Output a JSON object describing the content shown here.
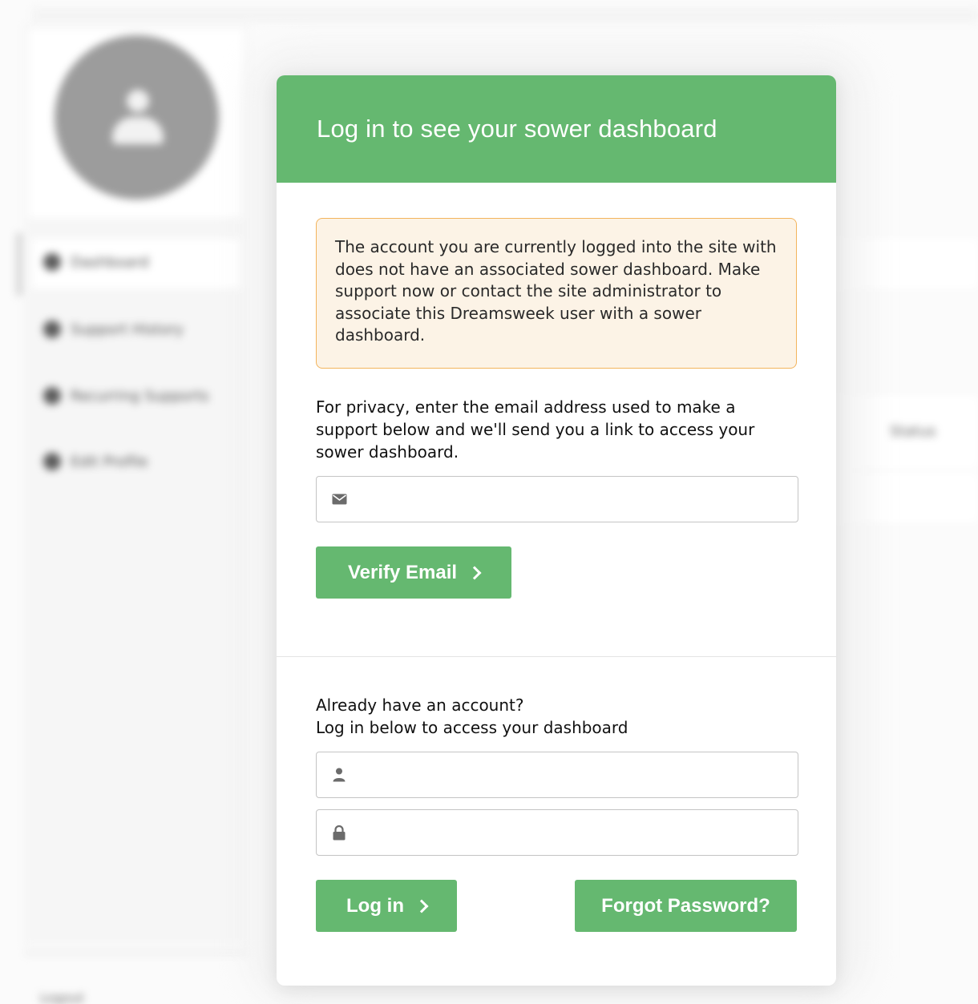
{
  "background": {
    "nav_items": [
      {
        "label": "Dashboard",
        "icon": "dashboard-icon"
      },
      {
        "label": "Support History",
        "icon": "history-icon"
      },
      {
        "label": "Recurring Supports",
        "icon": "recurring-icon"
      },
      {
        "label": "Edit Profile",
        "icon": "profile-icon"
      }
    ],
    "status_label": "Status",
    "logout_label": "Logout"
  },
  "modal": {
    "title": "Log in to see your sower dashboard",
    "alert_text": "The account you are currently logged into the site with does not have an associated sower dashboard. Make support now or contact the site administrator to associate this Dreamsweek user with a sower dashboard.",
    "privacy_text": "For privacy, enter the email address used to make a support below and we'll send you a link to access your sower dashboard.",
    "email_input": {
      "value": "",
      "placeholder": "",
      "icon": "envelope-icon"
    },
    "verify_button": "Verify Email",
    "login_prompt_line1": "Already have an account?",
    "login_prompt_line2": "Log in below to access your dashboard",
    "username_input": {
      "value": "",
      "placeholder": "",
      "icon": "user-icon"
    },
    "password_input": {
      "value": "",
      "placeholder": "",
      "icon": "lock-icon"
    },
    "login_button": "Log in",
    "forgot_button": "Forgot Password?"
  },
  "colors": {
    "accent_green": "#65b870",
    "alert_background": "#fcf3e6",
    "alert_border": "#f3b45c"
  }
}
